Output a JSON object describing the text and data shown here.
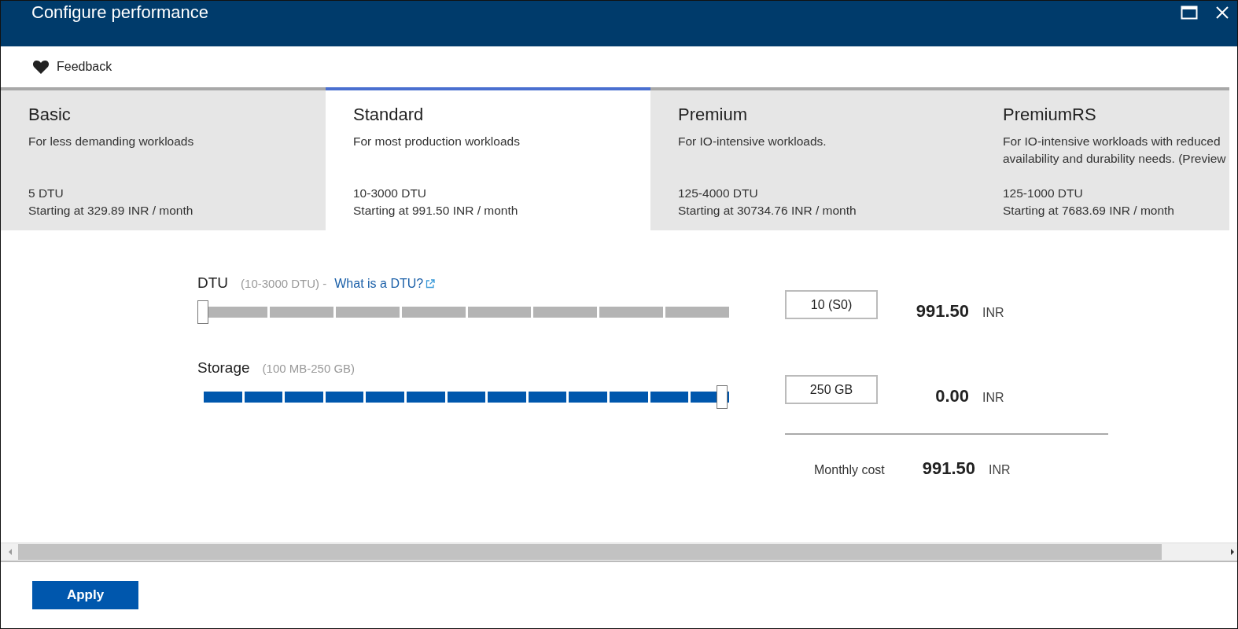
{
  "window": {
    "title": "Configure performance"
  },
  "toolbar": {
    "feedback": "Feedback"
  },
  "tiers": [
    {
      "name": "Basic",
      "description": "For less demanding workloads",
      "range": "5 DTU",
      "price": "Starting at 329.89 INR / month",
      "selected": false
    },
    {
      "name": "Standard",
      "description": "For most production workloads",
      "range": "10-3000 DTU",
      "price": "Starting at 991.50 INR / month",
      "selected": true
    },
    {
      "name": "Premium",
      "description": "For IO-intensive workloads.",
      "range": "125-4000 DTU",
      "price": "Starting at 30734.76 INR / month",
      "selected": false
    },
    {
      "name": "PremiumRS",
      "description": "For IO-intensive workloads with reduced availability and durability needs. (Preview",
      "range": "125-1000 DTU",
      "price": "Starting at 7683.69 INR / month",
      "selected": false
    }
  ],
  "sliders": [
    {
      "label": "DTU",
      "range": "(10-3000 DTU) -",
      "link": "What is a DTU?",
      "level": 0,
      "value": "10 (S0)",
      "cost": "991.50",
      "currency": "INR"
    },
    {
      "label": "Storage",
      "range": "(100 MB-250 GB)",
      "level": 1,
      "value": "250 GB",
      "cost": "0.00",
      "currency": "INR"
    }
  ],
  "total": {
    "label": "Monthly cost",
    "cost": "991.50",
    "currency": "INR"
  },
  "buttons": [
    "Apply"
  ]
}
